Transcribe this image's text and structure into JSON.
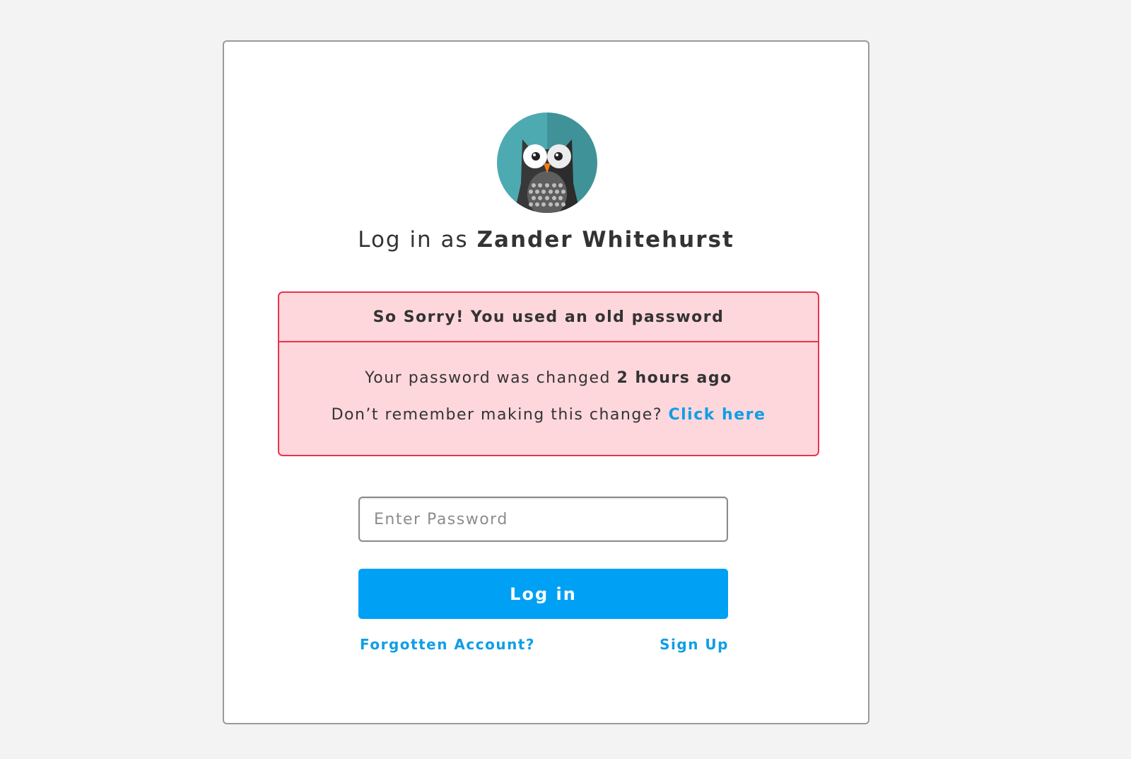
{
  "login": {
    "title_prefix": "Log in as",
    "user_name": "Zander Whitehurst",
    "avatar_icon": "owl-avatar-icon"
  },
  "alert": {
    "title": "So Sorry! You used an old password",
    "changed_prefix": "Your password was changed",
    "changed_time": "2 hours ago",
    "remember_prefix": "Don’t remember making this change?",
    "click_here_label": "Click here",
    "colors": {
      "background": "#fdd7dc",
      "border": "#e8344e"
    }
  },
  "form": {
    "password_placeholder": "Enter Password",
    "password_value": "",
    "login_label": "Log in",
    "forgot_label": "Forgotten Account?",
    "signup_label": "Sign Up"
  },
  "colors": {
    "accent": "#00a0f5",
    "link": "#109ee6",
    "avatar_teal": "#4eaab1"
  }
}
